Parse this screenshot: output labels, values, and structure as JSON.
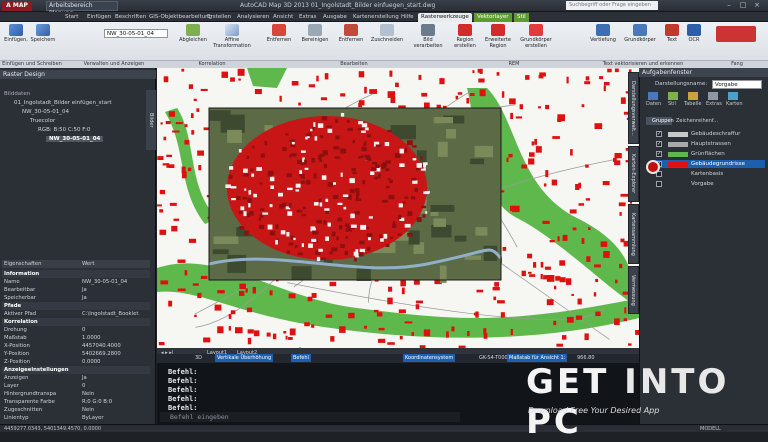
{
  "titlebar": {
    "logo": "A MAP",
    "workspace": "Arbeitsbereich Planung...",
    "title": "AutoCAD Map 3D 2013   01_Ingolstadt_Bilder einfuegen_start.dwg",
    "search_placeholder": "Suchbegriff oder Frage eingeben"
  },
  "tabs": [
    {
      "label": "Start"
    },
    {
      "label": "Einfügen"
    },
    {
      "label": "Beschriften"
    },
    {
      "label": "GIS-Objektbearbeitung"
    },
    {
      "label": "Erstellen"
    },
    {
      "label": "Analysieren"
    },
    {
      "label": "Ansicht"
    },
    {
      "label": "Extras"
    },
    {
      "label": "Ausgabe"
    },
    {
      "label": "Kartenerstellung"
    },
    {
      "label": "Hilfe"
    },
    {
      "label": "Rasterwerkzeuge"
    },
    {
      "label": "Vektorlayer"
    },
    {
      "label": "Stil"
    }
  ],
  "ribbon": {
    "buttons": [
      {
        "label": "Einfügen,"
      },
      {
        "label": "Speichern"
      },
      {
        "label": "Abgleichen"
      },
      {
        "label": "Affine Transformation"
      },
      {
        "label": "Entfernen"
      },
      {
        "label": "Bereinigen"
      },
      {
        "label": "Entfernen"
      },
      {
        "label": "Zuschneiden"
      },
      {
        "label": "Bild verarbeiten"
      },
      {
        "label": "Region erstellen"
      },
      {
        "label": "Erweiterte Region"
      },
      {
        "label": "Grundkörper erstellen"
      },
      {
        "label": "Vertiefung"
      },
      {
        "label": "Grundkörper"
      },
      {
        "label": "Text"
      },
      {
        "label": "OCR"
      }
    ],
    "image_select_value": "NW_30-05-01_04",
    "panels": [
      {
        "label": "Einfügen und Schreiben"
      },
      {
        "label": "Verwalten und Anzeigen"
      },
      {
        "label": "Korrelation"
      },
      {
        "label": "Bearbeiten"
      },
      {
        "label": "REM"
      },
      {
        "label": "Text vektorisieren und erkennen"
      },
      {
        "label": "Fang"
      }
    ]
  },
  "left_panel": {
    "title": "Raster Design",
    "section_bilddaten": "Bilddaten",
    "tree": [
      {
        "label": "01_Ingolstadt_Bilder einfügen_start"
      },
      {
        "label": "NW_30-05-01_04"
      },
      {
        "label": "Truecolor"
      },
      {
        "label": "RGB: B:50 C:50 F:0"
      },
      {
        "label": "NW_30-05-01_04"
      }
    ],
    "side_tab": "Bilder",
    "props_header_key": "Eigenschaften",
    "props_header_val": "Wert",
    "properties": [
      {
        "k": "Information",
        "v": "",
        "section": true
      },
      {
        "k": "Name",
        "v": "NW_30-05-01_04"
      },
      {
        "k": "Bearbeitbar",
        "v": "Ja"
      },
      {
        "k": "Speicherbar",
        "v": "Ja"
      },
      {
        "k": "Pfade",
        "v": "",
        "section": true
      },
      {
        "k": "Aktiver Pfad",
        "v": "C:\\Ingolstadt_Booklet"
      },
      {
        "k": "Korrelation",
        "v": "",
        "section": true
      },
      {
        "k": "Drehung",
        "v": "0"
      },
      {
        "k": "Maßstab",
        "v": "1.0000"
      },
      {
        "k": "X-Position",
        "v": "4457040.4000"
      },
      {
        "k": "Y-Position",
        "v": "5402669.2800"
      },
      {
        "k": "Z-Position",
        "v": "0.0000"
      },
      {
        "k": "Anzeigeeinstellungen",
        "v": "",
        "section": true
      },
      {
        "k": "Anzeigen",
        "v": "Ja"
      },
      {
        "k": "Layer",
        "v": "0"
      },
      {
        "k": "Hintergrundtranspa",
        "v": "Nein"
      },
      {
        "k": "Transparente Farbe",
        "v": "R:0 G:0 B:0"
      },
      {
        "k": "Zugeschnitten",
        "v": "Nein"
      },
      {
        "k": "Linientyp",
        "v": "ByLayer"
      }
    ]
  },
  "command": {
    "layout_tabs": [
      {
        "label": "Layout1"
      },
      {
        "label": "Layout2"
      }
    ],
    "status_tabs": [
      {
        "label": "3D"
      },
      {
        "label": "Vertikale Überhöhung"
      },
      {
        "label": "Befehl"
      },
      {
        "label": "Koordinatensystem"
      },
      {
        "label": "GK-S4-T000"
      },
      {
        "label": "Maßstab für Ansicht 1:"
      },
      {
        "label": "966.80"
      }
    ],
    "history": [
      "Befehl:",
      "Befehl:",
      "Befehl:",
      "Befehl:",
      "Befehl:"
    ],
    "input_placeholder": "Befehl eingeben"
  },
  "right_panel": {
    "title": "Aufgabenfenster",
    "display_label": "Darstellungsname:",
    "display_value": "Vorgabe",
    "tool_labels": [
      "Daten",
      "Stil",
      "Tabelle",
      "Extras",
      "Karten"
    ],
    "subtabs": [
      {
        "label": "Gruppen"
      },
      {
        "label": "Zeichenreihenf..."
      }
    ],
    "layers": [
      {
        "label": "Gebäudeschraffur",
        "checked": true,
        "color": "#c8c8c8"
      },
      {
        "label": "Hauptstrassen",
        "checked": true,
        "color": "#a8a8a8"
      },
      {
        "label": "Grünflächen",
        "checked": true,
        "color": "#5fb84c"
      },
      {
        "label": "Gebäudegrundrisse",
        "checked": true,
        "color": "#e01010",
        "selected": true
      },
      {
        "label": "Kartenbasis",
        "checked": false,
        "color": ""
      },
      {
        "label": "Vorgabe",
        "checked": false,
        "color": ""
      }
    ],
    "vtabs": [
      "Darstellungsverwalt...",
      "Karten-Explorer",
      "Kartensammlung",
      "Vermessung"
    ]
  },
  "statusbar": {
    "coords": "4459277.0343, 5401349.4570, 0.0000",
    "right": "MODELL"
  },
  "watermark": {
    "line1_a": "GET ",
    "line1_b": "INTO",
    "line1_c": " PC",
    "line2": "Download Free Your Desired App"
  },
  "colors": {
    "accent_green": "#5e9d2d",
    "building_red": "#e01010",
    "green_area": "#5fb84c",
    "selection_blue": "#1c5fae"
  }
}
